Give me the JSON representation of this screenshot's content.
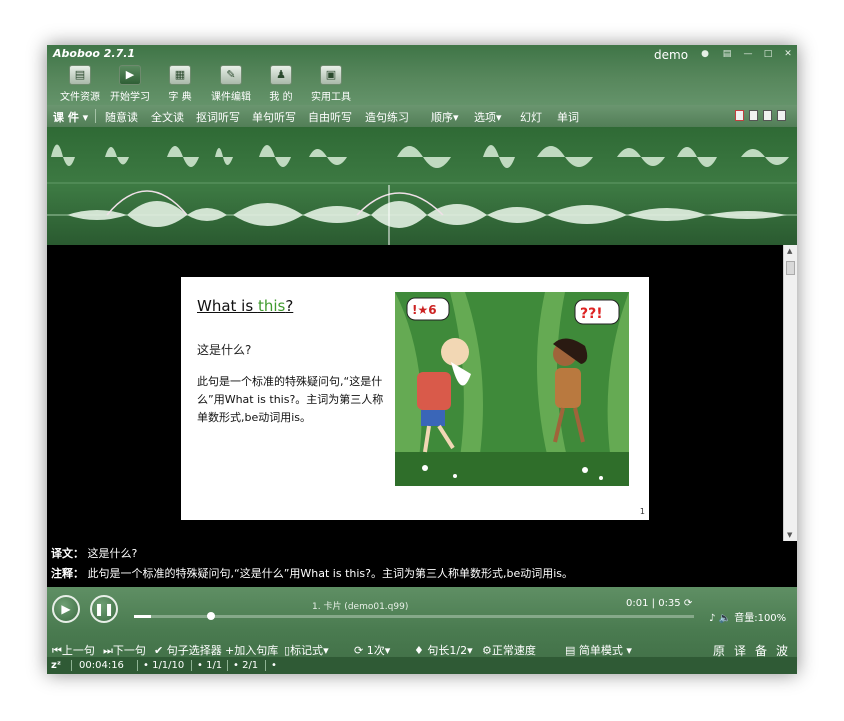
{
  "app": {
    "title": "Aboboo 2.7.1",
    "user": "demo"
  },
  "window_buttons": [
    "shirt-icon",
    "menu-icon",
    "minimize-icon",
    "maximize-icon",
    "close-icon"
  ],
  "toolbar": [
    {
      "label": "文件资源",
      "icon": "file-icon"
    },
    {
      "label": "开始学习",
      "icon": "play-icon",
      "active": true
    },
    {
      "label": "字 典",
      "icon": "book-icon"
    },
    {
      "label": "课件编辑",
      "icon": "edit-icon"
    },
    {
      "label": "我 的",
      "icon": "user-icon"
    },
    {
      "label": "实用工具",
      "icon": "toolbox-icon"
    }
  ],
  "modebar": {
    "course": "课 件",
    "modes": [
      "随意读",
      "全文读",
      "抠词听写",
      "单句听写",
      "自由听写",
      "造句练习"
    ],
    "menus": [
      "顺序",
      "选项",
      "幻灯",
      "单词"
    ]
  },
  "slide": {
    "title_prefix": "What is ",
    "title_keyword": "this",
    "title_suffix": "?",
    "translation": "这是什么?",
    "note": "此句是一个标准的特殊疑问句,“这是什么”用What is this?。主词为第三人称单数形式,be动词用is。",
    "page": "1",
    "bubble_left": "!★6",
    "bubble_right": "??!"
  },
  "translation_panel": {
    "translation_label": "译文：",
    "translation_text": "这是什么?",
    "note_label": "注释：",
    "note_text": "此句是一个标准的特殊疑问句,“这是什么”用What is this?。主词为第三人称单数形式,be动词用is。"
  },
  "player": {
    "track": "1. 卡片 (demo01.q99)",
    "current_time": "0:01",
    "total_time": "0:35",
    "progress": 0.03,
    "volume_label": "音量:100%",
    "controls": {
      "prev": "上一句",
      "next": "下一句",
      "sentence_selector": "句子选择器",
      "add_to_bank": "加入句库",
      "mark_mode": "标记式",
      "repeat": "1次",
      "sentence_length": "句长1/2",
      "speed": "正常速度",
      "simple_mode": "简单模式"
    },
    "chars": [
      "原",
      "译",
      "备",
      "波"
    ]
  },
  "status": {
    "sleep": "zᶻ",
    "elapsed": "00:04:16",
    "counter1": "• 1/1/10",
    "counter2": "• 1/1",
    "counter3": "• 2/1",
    "counter4": "•"
  },
  "colors": {
    "window_bg": "#1f3f23",
    "accent_green": "#3f9a2e",
    "waveform": "#cfe6cf"
  }
}
